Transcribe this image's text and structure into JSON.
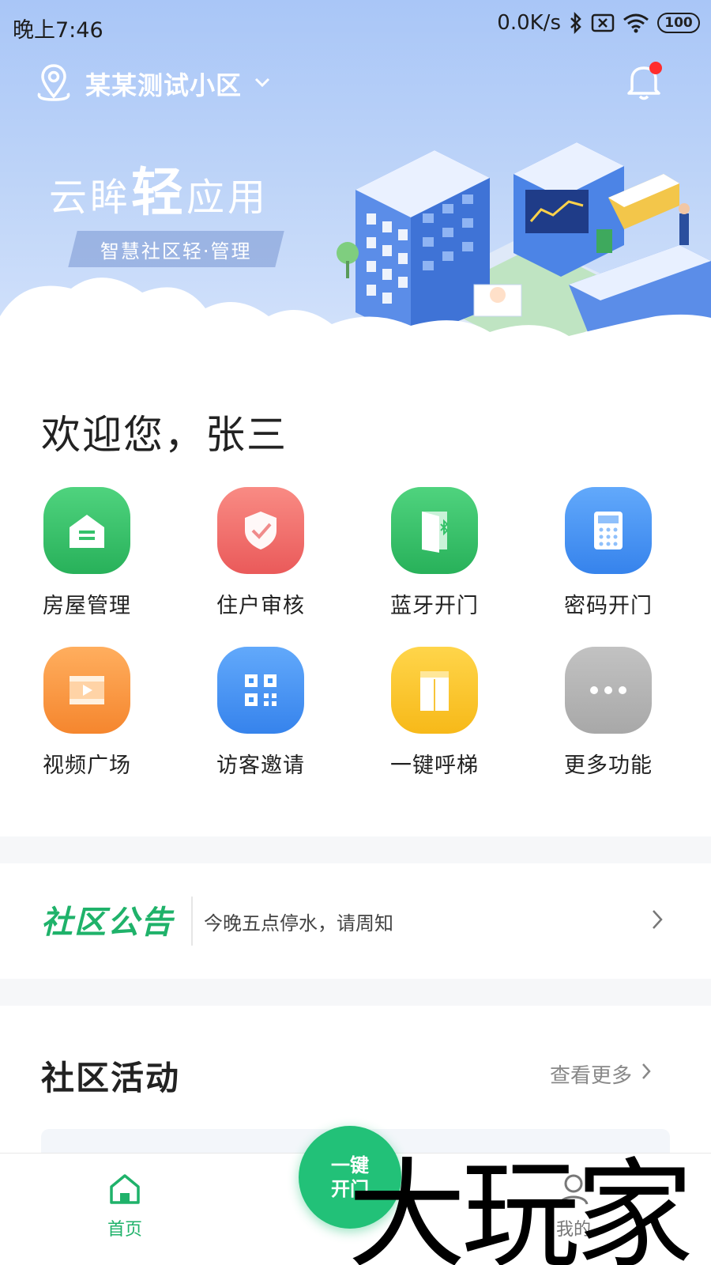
{
  "status_bar": {
    "time": "晚上7:46",
    "network_speed": "0.0K/s",
    "battery": "100"
  },
  "header": {
    "location": "某某测试小区",
    "notification_dot": true
  },
  "banner": {
    "title_pre": "云眸",
    "title_big": "轻",
    "title_post": "应用",
    "subtitle": "智慧社区轻·管理"
  },
  "welcome": "欢迎您，张三",
  "features": [
    {
      "label": "房屋管理",
      "icon": "house-icon",
      "color": "#35c26a"
    },
    {
      "label": "住户审核",
      "icon": "shield-check-icon",
      "color": "#f26d6d"
    },
    {
      "label": "蓝牙开门",
      "icon": "bluetooth-door-icon",
      "color": "#35c26a"
    },
    {
      "label": "密码开门",
      "icon": "keypad-icon",
      "color": "#3f93f3"
    },
    {
      "label": "视频广场",
      "icon": "video-icon",
      "color": "#fb9a45"
    },
    {
      "label": "访客邀请",
      "icon": "qr-code-icon",
      "color": "#3f93f3"
    },
    {
      "label": "一键呼梯",
      "icon": "elevator-icon",
      "color": "#fbc429"
    },
    {
      "label": "更多功能",
      "icon": "more-icon",
      "color": "#b6b6b6"
    }
  ],
  "notice": {
    "title": "社区公告",
    "text": "今晚五点停水，请周知"
  },
  "activities": {
    "title": "社区活动",
    "more": "查看更多"
  },
  "tabbar": {
    "home": "首页",
    "open_door": "一键开门",
    "mine": "我的"
  },
  "watermark": "大玩家",
  "colors": {
    "accent_green": "#22c178",
    "notice_green": "#1fb26a",
    "hero_blue": "#a9c6f7"
  }
}
